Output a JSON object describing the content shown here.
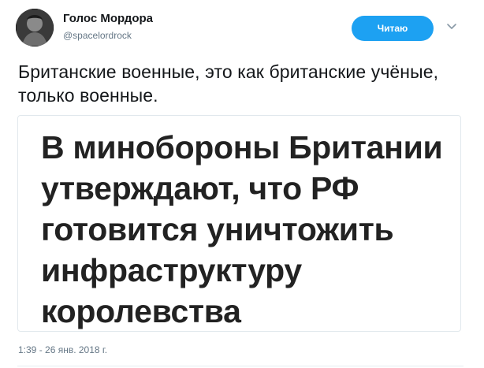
{
  "author": {
    "display_name": "Голос Мордора",
    "handle": "@spacelordrock"
  },
  "follow_button": {
    "label": "Читаю",
    "color": "#1da1f2"
  },
  "menu": {
    "icon": "chevron-down-icon"
  },
  "tweet": {
    "text": "Британские военные, это как британские учёные, только военные."
  },
  "media": {
    "headline_lines": [
      "В минобороны Британии",
      "утверждают, что РФ",
      "готовится уничтожить",
      "инфраструктуру",
      "королевства"
    ]
  },
  "timestamp": "1:39 - 26 янв. 2018 г."
}
